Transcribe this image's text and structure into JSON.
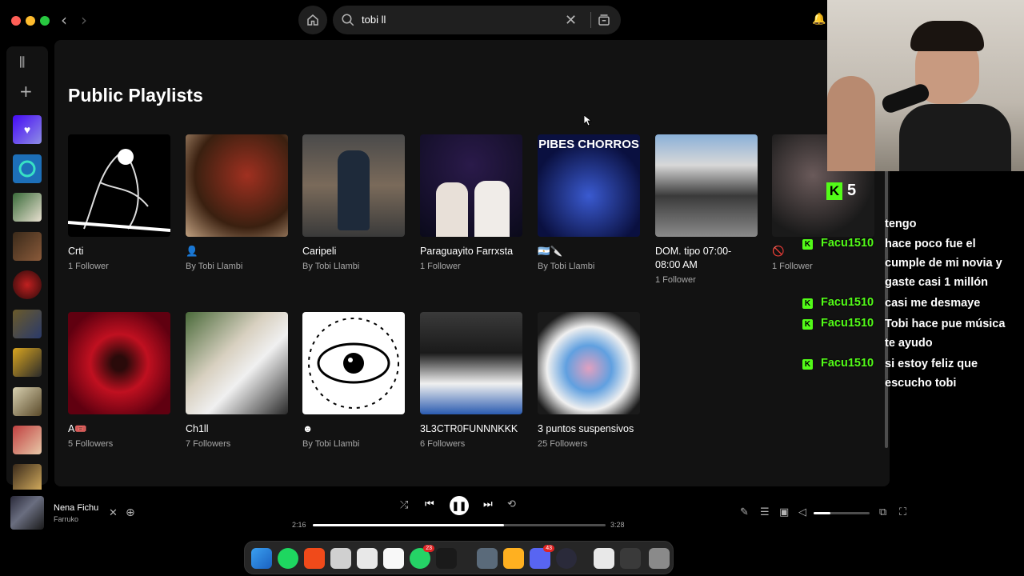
{
  "search": {
    "query": "tobi ll"
  },
  "section_title": "Public Playlists",
  "row1": [
    {
      "title": "Crti",
      "sub": "1 Follower"
    },
    {
      "title": "👤",
      "sub": "By Tobi Llambi"
    },
    {
      "title": "Caripeli",
      "sub": "By Tobi Llambi"
    },
    {
      "title": "Paraguayito Farrxsta",
      "sub": "1 Follower"
    },
    {
      "title": "🇦🇷🔪",
      "sub": "By Tobi Llambi",
      "cover_text": "PIBES CHORROS"
    },
    {
      "title": "DOM. tipo 07:00-08:00 AM",
      "sub": "1 Follower"
    },
    {
      "title": "🚫",
      "sub": "1 Follower"
    }
  ],
  "row2": [
    {
      "title": "A🎟️",
      "sub": "5 Followers"
    },
    {
      "title": "Ch1ll",
      "sub": "7 Followers"
    },
    {
      "title": "☻",
      "sub": "By Tobi Llambi"
    },
    {
      "title": "3L3CTR0FUNNNKKK",
      "sub": "6 Followers"
    },
    {
      "title": "3 puntos suspensivos",
      "sub": "25 Followers"
    }
  ],
  "player": {
    "track": "Nena Fichu",
    "artist": "Farruko",
    "elapsed": "2:16",
    "duration": "3:28",
    "progress": 0.654,
    "volume": 0.3
  },
  "dock": {
    "whatsapp_badge": "23",
    "discord_badge": "43"
  },
  "stream": {
    "viewer_count": "5",
    "chat": [
      {
        "user": "",
        "text": "tengo"
      },
      {
        "user": "Facu1510",
        "text": "hace poco fue el"
      },
      {
        "user": "",
        "text": "cumple de mi novia y"
      },
      {
        "user": "",
        "text": "gaste casi 1 millón"
      },
      {
        "user": "Facu1510",
        "text": "casi me desmaye"
      },
      {
        "user": "Facu1510",
        "text": "Tobi hace pue música"
      },
      {
        "user": "",
        "text": "te ayudo"
      },
      {
        "user": "Facu1510",
        "text": "si estoy feliz que"
      },
      {
        "user": "",
        "text": "escucho tobi"
      }
    ]
  },
  "colors": {
    "accent": "#1ed760",
    "kick_green": "#53fc18",
    "background": "#121212"
  }
}
